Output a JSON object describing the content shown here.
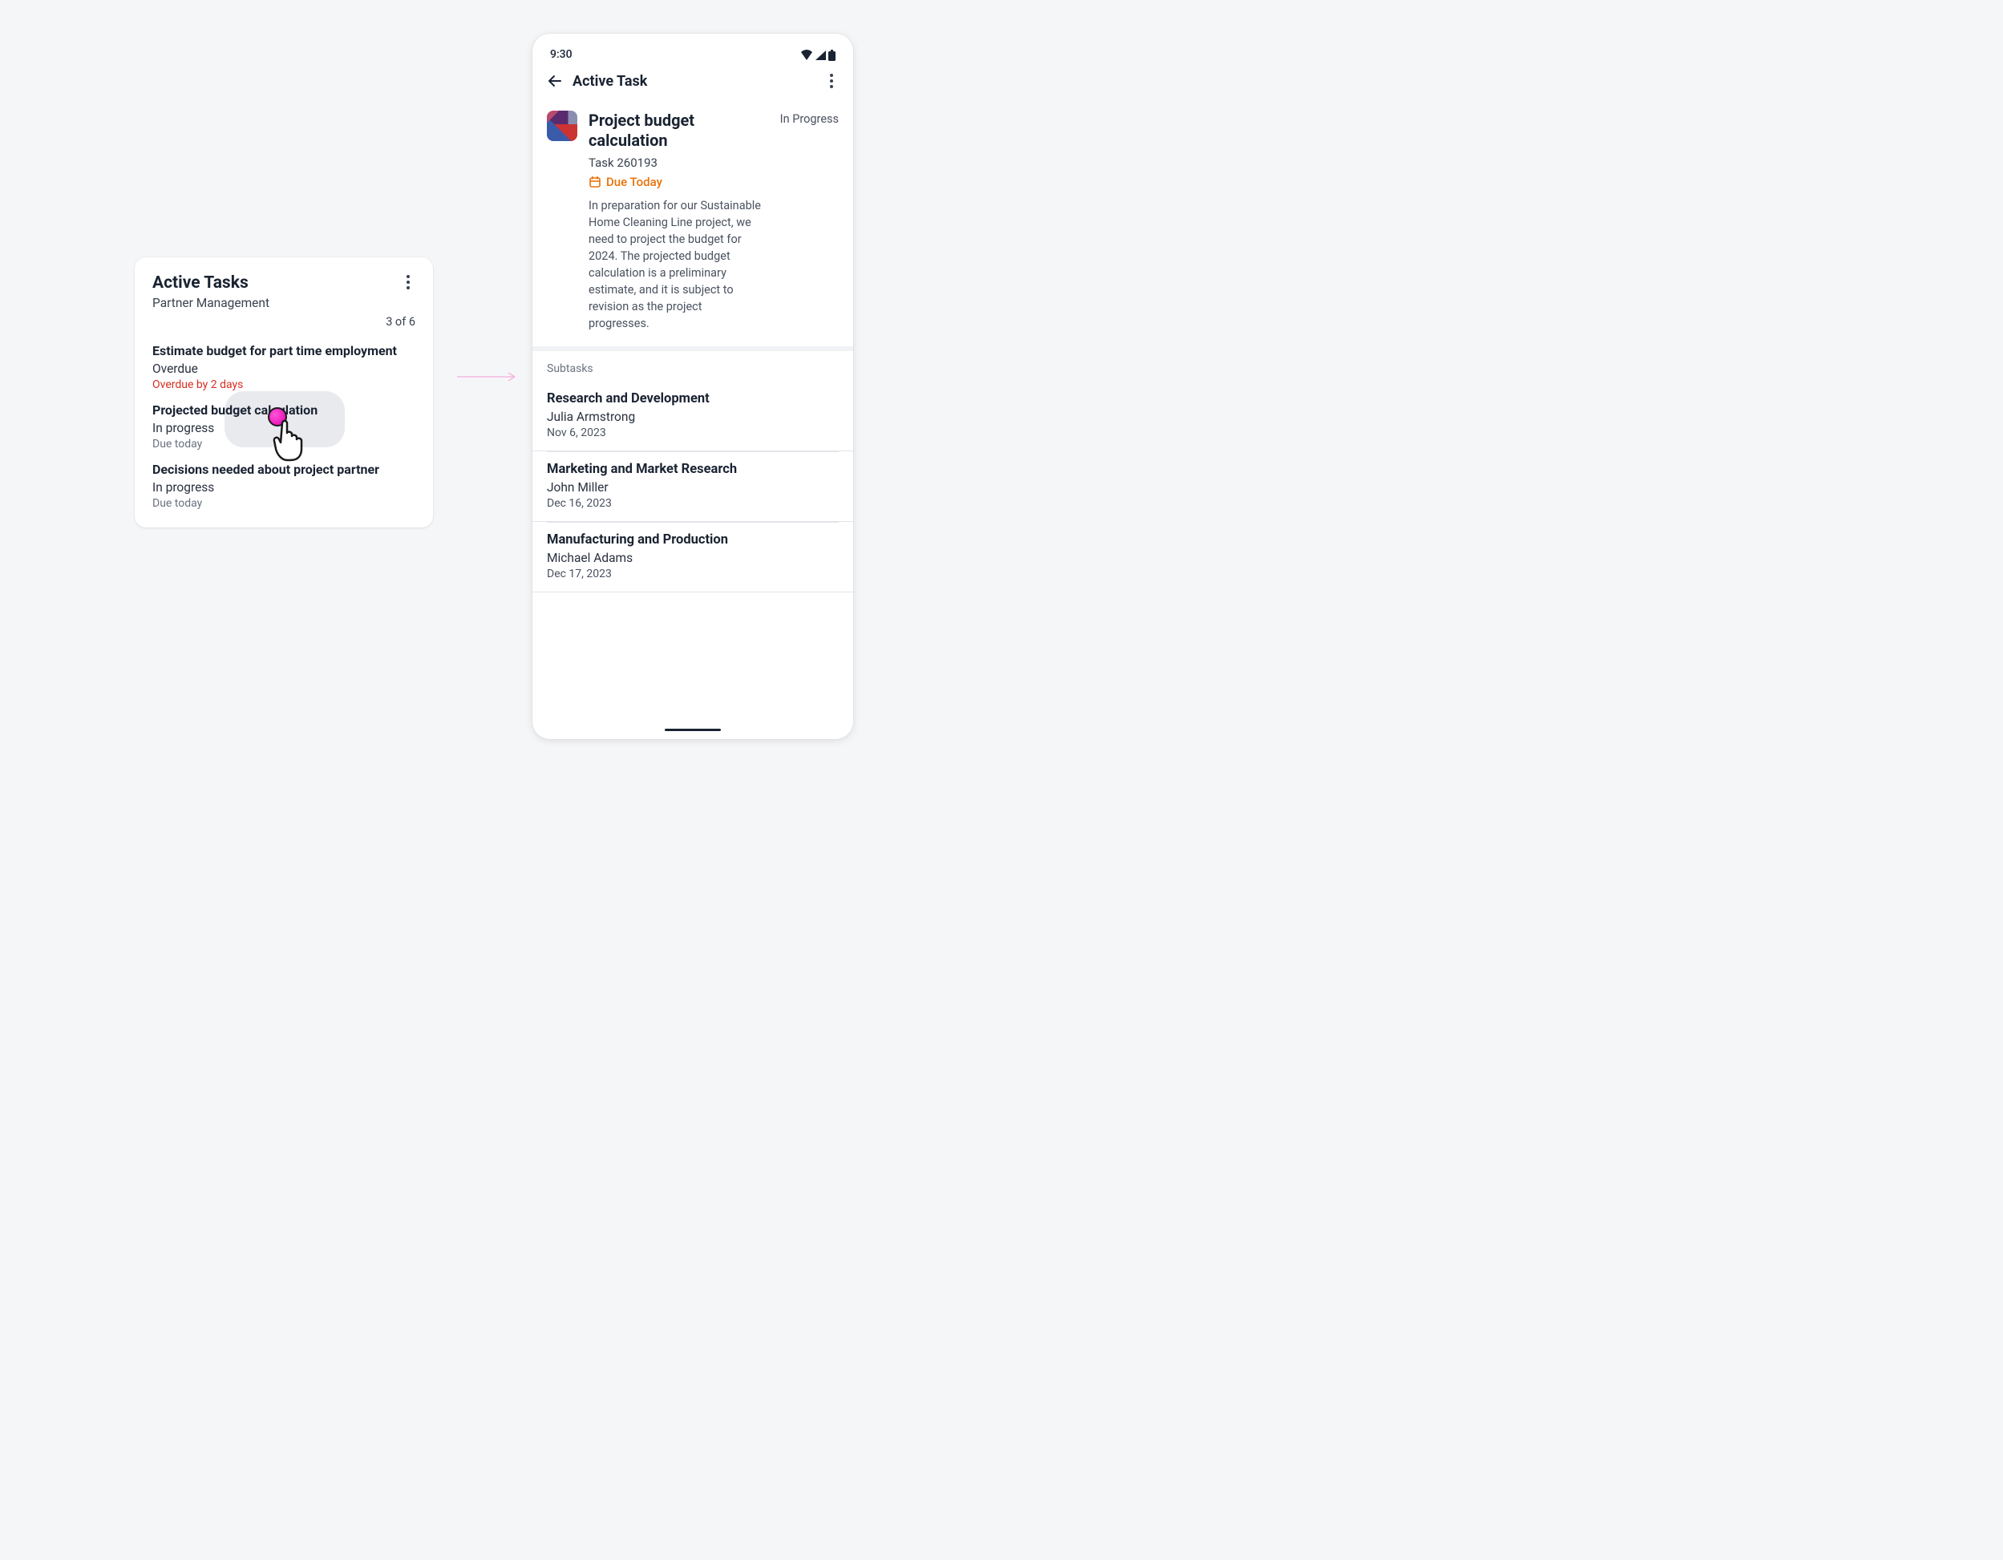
{
  "card": {
    "title": "Active Tasks",
    "subtitle": "Partner Management",
    "count": "3 of 6",
    "tasks": [
      {
        "title": "Estimate budget for part time employment",
        "status": "Overdue",
        "due": "Overdue by 2 days",
        "overdue": true
      },
      {
        "title": "Projected budget calculation",
        "status": "In progress",
        "due": "Due today",
        "overdue": false
      },
      {
        "title": "Decisions needed about project partner",
        "status": "In progress",
        "due": "Due today",
        "overdue": false
      }
    ]
  },
  "phone": {
    "status_time": "9:30",
    "appbar_title": "Active Task",
    "detail": {
      "title": "Project budget calculation",
      "status": "In Progress",
      "task_id": "Task 260193",
      "due": "Due Today",
      "description": "In preparation for our Sustainable Home Cleaning Line project, we need to project the budget for 2024. The projected budget calculation is a preliminary estimate, and it is subject to revision as the project progresses."
    },
    "subtasks_label": "Subtasks",
    "subtasks": [
      {
        "title": "Research and Development",
        "owner": "Julia Armstrong",
        "date": "Nov 6, 2023"
      },
      {
        "title": "Marketing and Market Research",
        "owner": "John Miller",
        "date": "Dec 16, 2023"
      },
      {
        "title": "Manufacturing and Production",
        "owner": "Michael Adams",
        "date": "Dec 17, 2023"
      }
    ]
  }
}
